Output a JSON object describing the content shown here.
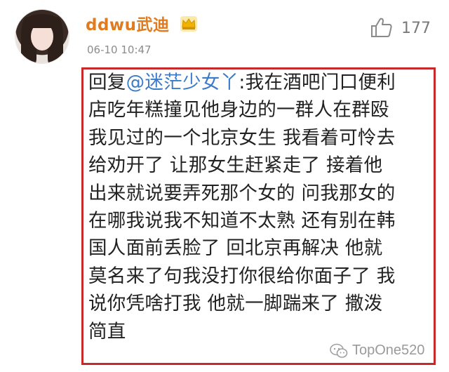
{
  "post": {
    "username": "ddwu武迪",
    "timestamp": "06-10 10:47",
    "like_count": "177"
  },
  "comment": {
    "prefix": "回复",
    "mention": "@迷茫少女丫",
    "lines": [
      ":我在酒吧门口便利",
      "店吃年糕撞见他身边的一群人在群殴",
      "我见过的一个北京女生 我看着可怜去",
      "给劝开了 让那女生赶紧走了 接着他",
      "出来就说要弄死那个女的 问我那女的",
      "在哪我说我不知道不太熟 还有别在韩",
      "国人面前丢脸了 回北京再解决 他就",
      "莫名来了句我没打你很给你面子了 我",
      "说你凭啥打我 他就一脚踹来了 撒泼",
      "简直"
    ]
  },
  "watermark": {
    "text": "TopOne520",
    "icon": "wechat-icon"
  },
  "colors": {
    "username": "#e07b1f",
    "mention": "#3b7bc8",
    "highlight_border": "#c72a2a",
    "crown": "#f0b400"
  }
}
